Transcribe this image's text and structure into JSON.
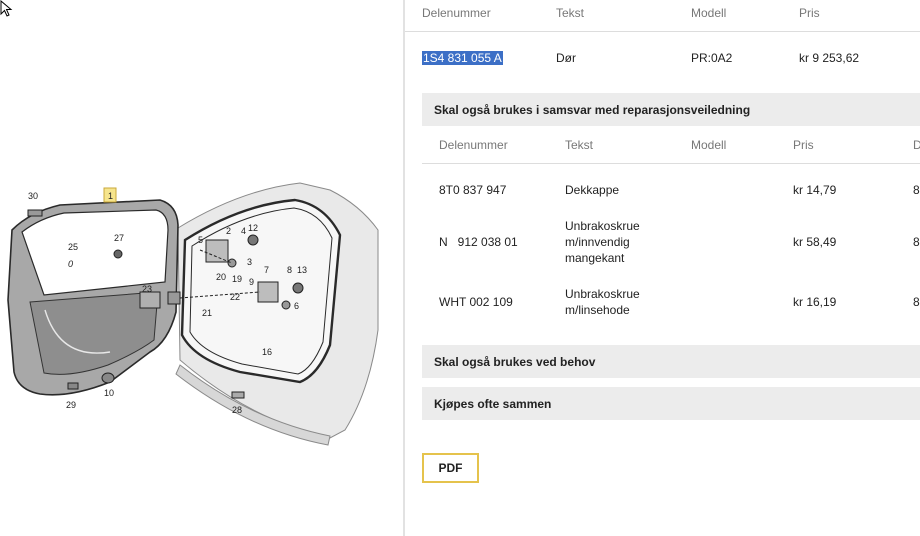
{
  "diagram": {
    "callouts": [
      "30",
      "1",
      "25",
      "0",
      "27",
      "5",
      "2",
      "4",
      "12",
      "3",
      "20",
      "19",
      "7",
      "8",
      "13",
      "9",
      "23",
      "22",
      "21",
      "6",
      "16",
      "29",
      "10",
      "28"
    ]
  },
  "parts_table": {
    "headers": {
      "part_number": "Delenummer",
      "text": "Tekst",
      "model": "Modell",
      "price": "Pris"
    },
    "row": {
      "part_number": "1S4 831 055 A",
      "text": "Dør",
      "model": "PR:0A2",
      "price": "kr 9 253,62"
    }
  },
  "sections": {
    "repair_title": "Skal også brukes i samsvar med reparasjonsveiledning",
    "as_needed_title": "Skal også brukes ved behov",
    "bought_together_title": "Kjøpes ofte sammen"
  },
  "related_table": {
    "headers": {
      "part_number": "Delenummer",
      "text": "Tekst",
      "model": "Modell",
      "price": "Pris",
      "extra": "D"
    },
    "rows": [
      {
        "part_number": "8T0 837 947",
        "text": "Dekkappe",
        "model": "",
        "price": "kr 14,79",
        "extra": "8"
      },
      {
        "part_number": "N   912 038 01",
        "text_lines": [
          "Unbrakoskrue",
          "m/innvendig",
          "mangekant"
        ],
        "model": "",
        "price": "kr 58,49",
        "extra": "8"
      },
      {
        "part_number": "WHT 002 109",
        "text_lines": [
          "Unbrakoskrue",
          "m/linsehode"
        ],
        "model": "",
        "price": "kr 16,19",
        "extra": "8"
      }
    ]
  },
  "pdf_button": {
    "label": "PDF"
  },
  "colors": {
    "highlight": "#3c6fc6",
    "section_bg": "#ececec",
    "pdf_border": "#e5c34c",
    "callout_highlight": "#f6e58d"
  }
}
